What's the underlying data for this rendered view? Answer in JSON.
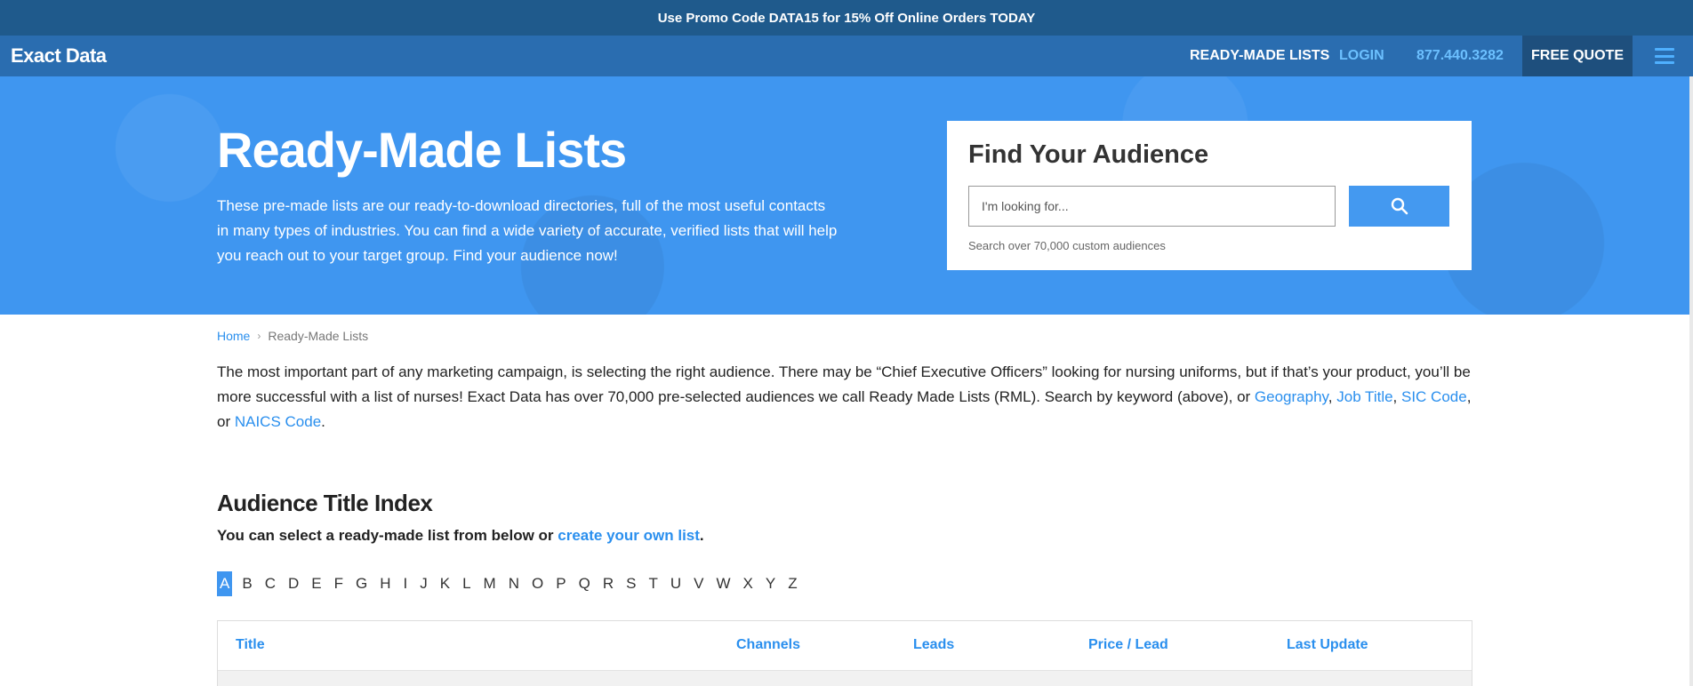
{
  "promo": {
    "text": "Use Promo Code DATA15 for 15% Off Online Orders TODAY"
  },
  "nav": {
    "brand": "Exact Data",
    "ready_made_lists": "READY-MADE LISTS",
    "login": "LOGIN",
    "phone": "877.440.3282",
    "free_quote": "FREE QUOTE",
    "menu_icon": "hamburger-menu-icon"
  },
  "hero": {
    "title": "Ready-Made Lists",
    "description": "These pre-made lists are our ready-to-download directories, full of the most useful contacts in many types of industries. You can find a wide variety of accurate, verified lists that will help you reach out to your target group. Find your audience now!"
  },
  "search": {
    "title": "Find Your Audience",
    "placeholder": "I'm looking for...",
    "value": "",
    "button_icon": "search-icon",
    "hint": "Search over 70,000 custom audiences"
  },
  "breadcrumb": {
    "home": "Home",
    "separator": "›",
    "current": "Ready-Made Lists"
  },
  "intro": {
    "text_1": "The most important part of any marketing campaign, is selecting the right audience. There may be “Chief Executive Officers” looking for nursing uniforms, but if that’s your product, you’ll be more successful with a list of nurses! Exact Data has over 70,000 pre-selected audiences we call Ready Made Lists (RML). Search by keyword (above), or ",
    "link_geography": "Geography",
    "comma_1": ", ",
    "link_job_title": "Job Title",
    "comma_2": ", ",
    "link_sic": "SIC Code",
    "or_text": ", or ",
    "link_naics": "NAICS Code",
    "period": "."
  },
  "index": {
    "title": "Audience Title Index",
    "subtitle_text": "You can select a ready-made list from below or ",
    "subtitle_link": "create your own list",
    "subtitle_end": ".",
    "letters": [
      "A",
      "B",
      "C",
      "D",
      "E",
      "F",
      "G",
      "H",
      "I",
      "J",
      "K",
      "L",
      "M",
      "N",
      "O",
      "P",
      "Q",
      "R",
      "S",
      "T",
      "U",
      "V",
      "W",
      "X",
      "Y",
      "Z"
    ],
    "active_letter": "A"
  },
  "table": {
    "columns": [
      "Title",
      "Channels",
      "Leads",
      "Price / Lead",
      "Last Update"
    ]
  },
  "colors": {
    "promo_bg": "#1f5a8c",
    "nav_bg": "#2a6db0",
    "hero_bg": "#3f96f0",
    "link": "#2a8fee",
    "accent": "#4499f0"
  }
}
